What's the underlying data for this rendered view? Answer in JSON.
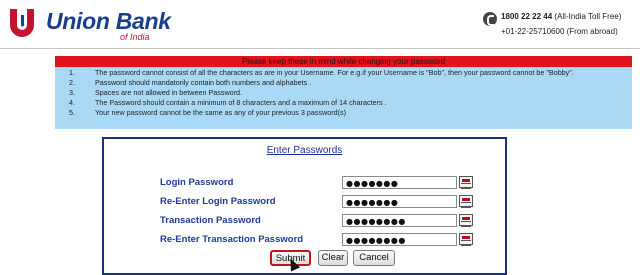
{
  "header": {
    "brand": "Union Bank",
    "brand_sub": "of India",
    "phone_primary": "1800 22 22 44",
    "phone_primary_note": "(All-India Toll Free)",
    "phone_secondary": "+01-22-25710600 (From abroad)"
  },
  "rules": {
    "title": "Please keep these in mind while changing your password",
    "items": [
      {
        "num": "1.",
        "text": "The password cannot consist of all the characters as are in your Username. For e.g.if your Username is \"Bob\", then your password cannot be \"Bobby\"."
      },
      {
        "num": "2.",
        "text": "Password should mandatorily contain both numbers and alphabets ."
      },
      {
        "num": "3.",
        "text": "Spaces are not allowed in between Password."
      },
      {
        "num": "4.",
        "text": "The Password should contain a minimum of 8 characters and a maximum of 14 characters ."
      },
      {
        "num": "5.",
        "text": "Your new password cannot be the same as any of your previous 3 password(s)"
      }
    ]
  },
  "form": {
    "title": "Enter Passwords",
    "fields": [
      {
        "label": "Login Password",
        "value": "●●●●●●●"
      },
      {
        "label": "Re-Enter Login Password",
        "value": "●●●●●●●"
      },
      {
        "label": "Transaction Password",
        "value": "●●●●●●●●"
      },
      {
        "label": "Re-Enter Transaction Password",
        "value": "●●●●●●●●"
      }
    ],
    "buttons": {
      "submit": "Submit",
      "clear": "Clear",
      "cancel": "Cancel"
    }
  },
  "colors": {
    "brand_blue": "#1a3e8c",
    "brand_red": "#c4122f",
    "rules_bg": "#a9d9f5",
    "rules_header": "#e3121b"
  },
  "icons": {
    "logo": "union-bank-logo",
    "phone": "phone-icon",
    "keyboard": "virtual-keyboard-icon",
    "cursor": "mouse-pointer-icon"
  }
}
